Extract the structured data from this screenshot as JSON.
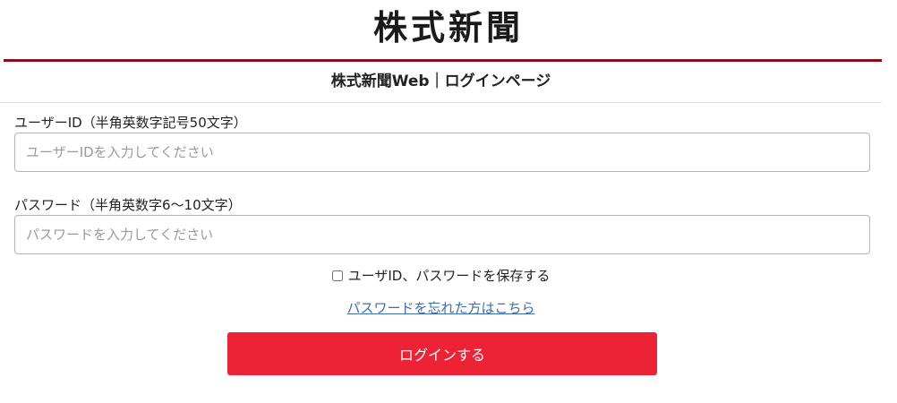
{
  "header": {
    "logo_text": "株式新聞",
    "page_title": "株式新聞Web｜ログインページ",
    "brand_color": "#8b0f1a"
  },
  "form": {
    "user_id": {
      "label": "ユーザーID（半角英数字記号50文字）",
      "placeholder": "ユーザーIDを入力してください",
      "value": ""
    },
    "password": {
      "label": "パスワード（半角英数字6～10文字）",
      "placeholder": "パスワードを入力してください",
      "value": ""
    },
    "remember": {
      "label": "ユーザID、パスワードを保存する",
      "checked": false
    },
    "forgot_link_text": "パスワードを忘れた方はこちら",
    "login_button_label": "ログインする",
    "login_button_color": "#ed2335"
  }
}
